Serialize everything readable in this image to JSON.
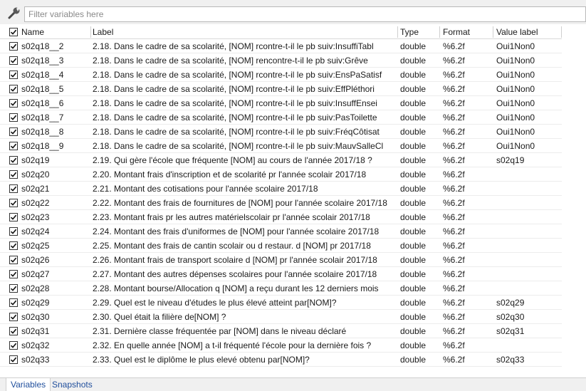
{
  "filter": {
    "placeholder": "Filter variables here"
  },
  "columns": {
    "name": "Name",
    "label": "Label",
    "type": "Type",
    "format": "Format",
    "value_label": "Value label"
  },
  "rows": [
    {
      "name": "s02q18__2",
      "label": "2.18. Dans le cadre de sa scolarité, [NOM] rcontre-t-il le pb suiv:InsuffiTabl",
      "type": "double",
      "format": "%6.2f",
      "value_label": "Oui1Non0"
    },
    {
      "name": "s02q18__3",
      "label": "2.18. Dans le cadre de sa scolarité, [NOM] rencontre-t-il le pb suiv:Grêve",
      "type": "double",
      "format": "%6.2f",
      "value_label": "Oui1Non0"
    },
    {
      "name": "s02q18__4",
      "label": "2.18. Dans le cadre de sa scolarité, [NOM] rcontre-t-il le pb suiv:EnsPaSatisf",
      "type": "double",
      "format": "%6.2f",
      "value_label": "Oui1Non0"
    },
    {
      "name": "s02q18__5",
      "label": "2.18. Dans le cadre de sa scolarité, [NOM] rcontre-t-il le pb suiv:EffPléthori",
      "type": "double",
      "format": "%6.2f",
      "value_label": "Oui1Non0"
    },
    {
      "name": "s02q18__6",
      "label": "2.18. Dans le cadre de sa scolarité, [NOM] rcontre-t-il le pb suiv:InsuffEnsei",
      "type": "double",
      "format": "%6.2f",
      "value_label": "Oui1Non0"
    },
    {
      "name": "s02q18__7",
      "label": "2.18. Dans le cadre de sa scolarité, [NOM] rcontre-t-il le pb suiv:PasToilette",
      "type": "double",
      "format": "%6.2f",
      "value_label": "Oui1Non0"
    },
    {
      "name": "s02q18__8",
      "label": "2.18. Dans le cadre de sa scolarité, [NOM] rcontre-t-il le pb suiv:FréqCôtisat",
      "type": "double",
      "format": "%6.2f",
      "value_label": "Oui1Non0"
    },
    {
      "name": "s02q18__9",
      "label": "2.18. Dans le cadre de sa scolarité, [NOM] rcontre-t-il le pb suiv:MauvSalleCl",
      "type": "double",
      "format": "%6.2f",
      "value_label": "Oui1Non0"
    },
    {
      "name": "s02q19",
      "label": "2.19. Qui gère l'école que fréquente [NOM] au cours de l'année 2017/18 ?",
      "type": "double",
      "format": "%6.2f",
      "value_label": "s02q19"
    },
    {
      "name": "s02q20",
      "label": "2.20. Montant frais d'inscription et de scolarité pr l'année scolair 2017/18",
      "type": "double",
      "format": "%6.2f",
      "value_label": ""
    },
    {
      "name": "s02q21",
      "label": "2.21. Montant des cotisations pour l'année scolaire 2017/18",
      "type": "double",
      "format": "%6.2f",
      "value_label": ""
    },
    {
      "name": "s02q22",
      "label": "2.22. Montant des frais de fournitures de [NOM] pour l'année scolaire 2017/18",
      "type": "double",
      "format": "%6.2f",
      "value_label": ""
    },
    {
      "name": "s02q23",
      "label": "2.23. Montant frais pr les autres matérielscolair pr l'année scolair 2017/18",
      "type": "double",
      "format": "%6.2f",
      "value_label": ""
    },
    {
      "name": "s02q24",
      "label": "2.24. Montant des frais d'uniformes de [NOM] pour l'année scolaire 2017/18",
      "type": "double",
      "format": "%6.2f",
      "value_label": ""
    },
    {
      "name": "s02q25",
      "label": "2.25. Montant des frais de cantin scolair ou d restaur. d [NOM] pr 2017/18",
      "type": "double",
      "format": "%6.2f",
      "value_label": ""
    },
    {
      "name": "s02q26",
      "label": "2.26. Montant frais de transport scolaire d [NOM] pr l'année scolair 2017/18",
      "type": "double",
      "format": "%6.2f",
      "value_label": ""
    },
    {
      "name": "s02q27",
      "label": "2.27. Montant des autres dépenses scolaires pour l'année scolaire 2017/18",
      "type": "double",
      "format": "%6.2f",
      "value_label": ""
    },
    {
      "name": "s02q28",
      "label": "2.28. Montant bourse/Allocation q [NOM] a reçu durant les 12 derniers mois",
      "type": "double",
      "format": "%6.2f",
      "value_label": ""
    },
    {
      "name": "s02q29",
      "label": "2.29. Quel est le niveau d'études le plus élevé atteint par[NOM]?",
      "type": "double",
      "format": "%6.2f",
      "value_label": "s02q29"
    },
    {
      "name": "s02q30",
      "label": "2.30. Quel était  la filière de[NOM] ?",
      "type": "double",
      "format": "%6.2f",
      "value_label": "s02q30"
    },
    {
      "name": "s02q31",
      "label": "2.31. Dernière classe fréquentée par [NOM]  dans le niveau déclaré",
      "type": "double",
      "format": "%6.2f",
      "value_label": "s02q31"
    },
    {
      "name": "s02q32",
      "label": "2.32. En quelle année [NOM] a t-il fréquenté l'école pour la dernière fois ?",
      "type": "double",
      "format": "%6.2f",
      "value_label": ""
    },
    {
      "name": "s02q33",
      "label": "2.33. Quel est le diplôme le plus elevé obtenu par[NOM]?",
      "type": "double",
      "format": "%6.2f",
      "value_label": "s02q33"
    }
  ],
  "tabs": [
    {
      "label": "Variables",
      "active": true
    },
    {
      "label": "Snapshots",
      "active": false
    }
  ]
}
